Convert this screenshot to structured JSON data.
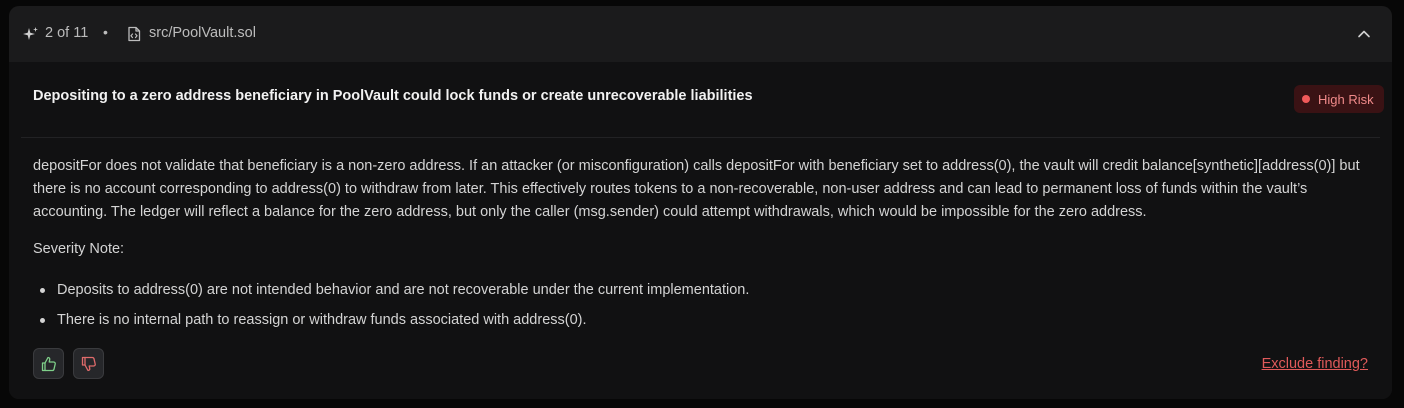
{
  "header": {
    "counter": "2 of 11",
    "separator": "•",
    "file": "src/PoolVault.sol"
  },
  "finding": {
    "title": "Depositing to a zero address beneficiary in PoolVault could lock funds or create unrecoverable liabilities",
    "risk_label": "High Risk",
    "description": "depositFor does not validate that beneficiary is a non-zero address. If an attacker (or misconfiguration) calls depositFor with beneficiary set to address(0), the vault will credit balance[synthetic][address(0)] but there is no account corresponding to address(0) to withdraw from later. This effectively routes tokens to a non-recoverable, non-user address and can lead to permanent loss of funds within the vault’s accounting. The ledger will reflect a balance for the zero address, but only the caller (msg.sender) could attempt withdrawals, which would be impossible for the zero address.",
    "severity_heading": "Severity Note:",
    "severity_points": [
      "Deposits to address(0) are not intended behavior and are not recoverable under the current implementation.",
      "There is no internal path to reassign or withdraw funds associated with address(0)."
    ]
  },
  "actions": {
    "exclude_label": "Exclude finding?"
  },
  "colors": {
    "risk_accent": "#f05a5a",
    "thumbs_up": "#7fd08a",
    "thumbs_down": "#e06b6b"
  },
  "icons": {
    "counter": "sparkle-icon",
    "file": "file-code-icon",
    "collapse": "chevron-up-icon",
    "upvote": "thumbs-up-icon",
    "downvote": "thumbs-down-icon"
  }
}
